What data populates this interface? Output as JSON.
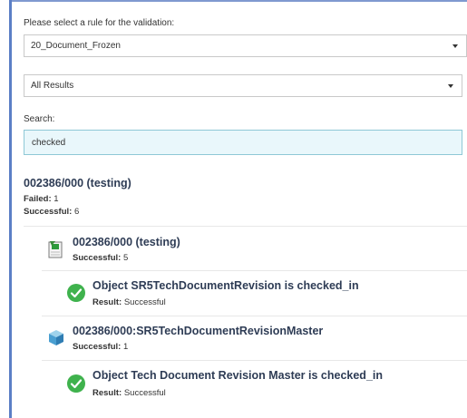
{
  "rule_label": "Please select a rule for the validation:",
  "rule_value": "20_Document_Frozen",
  "filter_value": "All Results",
  "search_label": "Search:",
  "search_value": "checked",
  "root": {
    "title": "002386/000 (testing)",
    "failed_label": "Failed:",
    "failed_value": "1",
    "successful_label": "Successful:",
    "successful_value": "6"
  },
  "doc_node": {
    "title": "002386/000 (testing)",
    "successful_label": "Successful:",
    "successful_value": "5",
    "icon": "document-icon"
  },
  "check1": {
    "title": "Object SR5TechDocumentRevision is checked_in",
    "result_label": "Result:",
    "result_value": "Successful",
    "icon": "check-circle-icon"
  },
  "master_node": {
    "title": "002386/000:SR5TechDocumentRevisionMaster",
    "successful_label": "Successful:",
    "successful_value": "1",
    "icon": "cube-icon"
  },
  "check2": {
    "title": "Object Tech Document Revision Master is checked_in",
    "result_label": "Result:",
    "result_value": "Successful",
    "icon": "check-circle-icon"
  },
  "colors": {
    "frame": "#5b7fc6",
    "search_bg": "#e9f7fb",
    "search_border": "#8ec8d6",
    "success": "#3fb24d",
    "title": "#2e3c55"
  }
}
